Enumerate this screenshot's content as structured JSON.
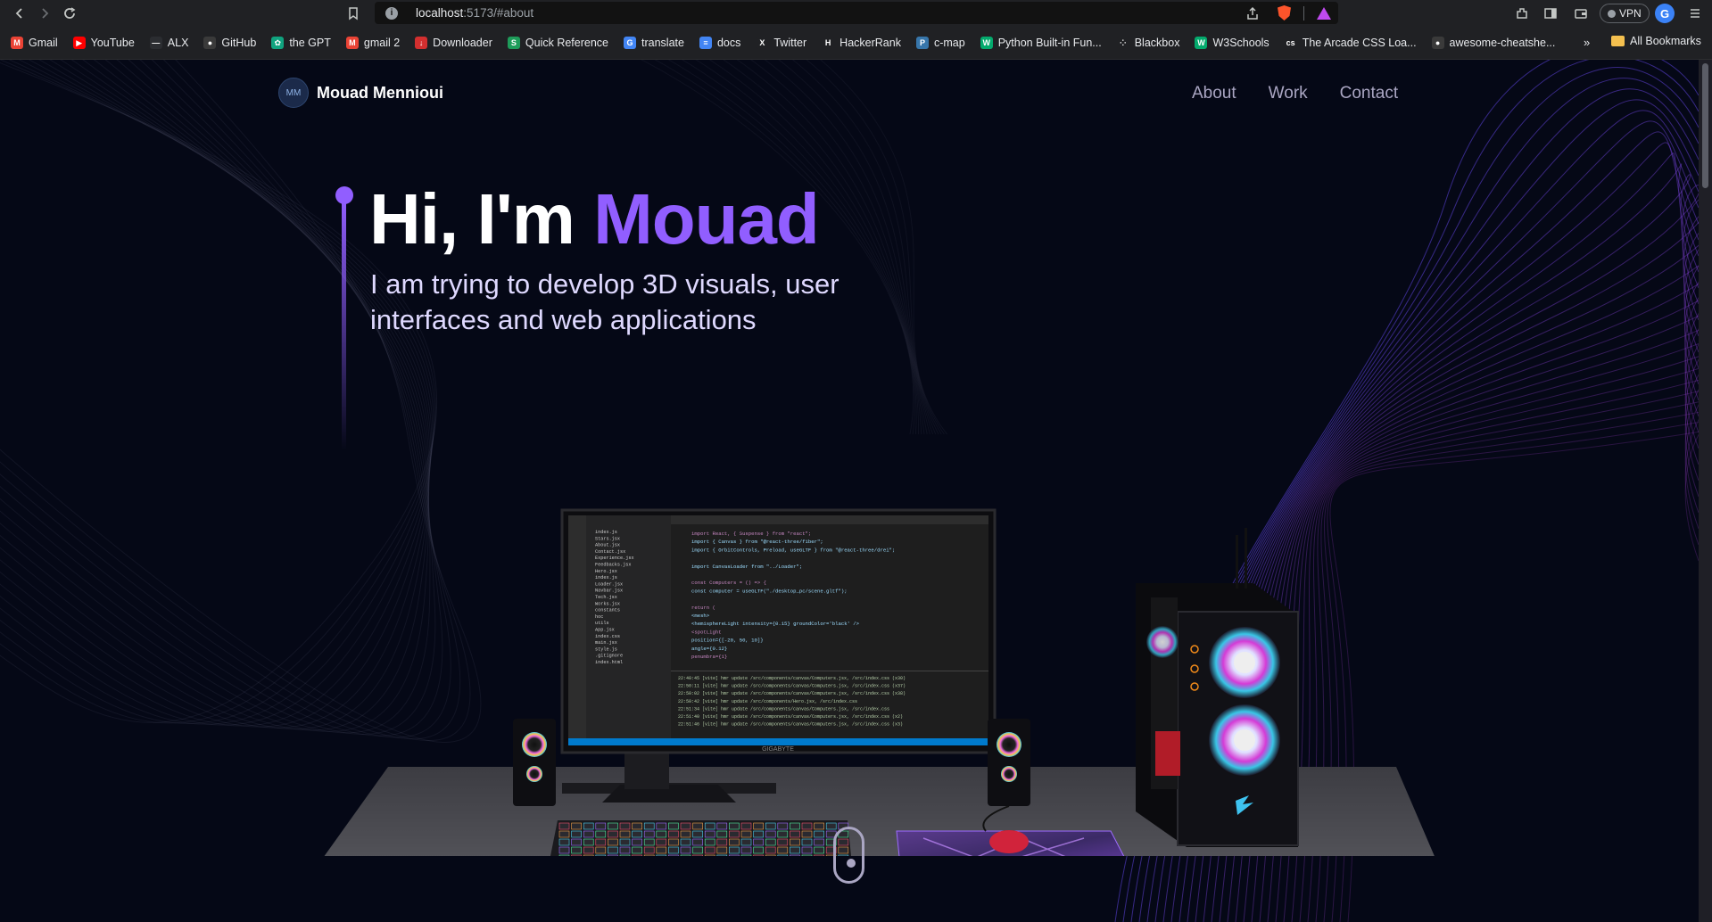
{
  "browser": {
    "url_host": "localhost",
    "url_path": ":5173/#about",
    "vpn_label": "VPN",
    "profile_initial": "G",
    "bookmarks": [
      {
        "label": "Gmail",
        "icon": "gmail-icon",
        "color": "#ea4335",
        "glyph": "M"
      },
      {
        "label": "YouTube",
        "icon": "youtube-icon",
        "color": "#ff0000",
        "glyph": "▶"
      },
      {
        "label": "ALX",
        "icon": "alx-icon",
        "color": "#2b2d31",
        "glyph": "—"
      },
      {
        "label": "GitHub",
        "icon": "github-icon",
        "color": "#3a3a3a",
        "glyph": "●"
      },
      {
        "label": "the GPT",
        "icon": "chatgpt-icon",
        "color": "#10a37f",
        "glyph": "✿"
      },
      {
        "label": "gmail 2",
        "icon": "gmail-icon",
        "color": "#ea4335",
        "glyph": "M"
      },
      {
        "label": "Downloader",
        "icon": "downloader-icon",
        "color": "#d32f2f",
        "glyph": "↓"
      },
      {
        "label": "Quick Reference",
        "icon": "quick-reference-icon",
        "color": "#1e9c5a",
        "glyph": "S"
      },
      {
        "label": "translate",
        "icon": "translate-icon",
        "color": "#4285f4",
        "glyph": "G"
      },
      {
        "label": "docs",
        "icon": "docs-icon",
        "color": "#4285f4",
        "glyph": "≡"
      },
      {
        "label": "Twitter",
        "icon": "x-icon",
        "color": "#202124",
        "glyph": "X"
      },
      {
        "label": "HackerRank",
        "icon": "hackerrank-icon",
        "color": "#202124",
        "glyph": "H"
      },
      {
        "label": "c-map",
        "icon": "python-icon",
        "color": "#3776ab",
        "glyph": "P"
      },
      {
        "label": "Python Built-in Fun...",
        "icon": "w3-icon",
        "color": "#04aa6d",
        "glyph": "W"
      },
      {
        "label": "Blackbox",
        "icon": "blackbox-icon",
        "color": "#202124",
        "glyph": "⁘"
      },
      {
        "label": "W3Schools",
        "icon": "w3schools-icon",
        "color": "#04aa6d",
        "glyph": "W"
      },
      {
        "label": "The Arcade CSS Loa...",
        "icon": "css-icon",
        "color": "#202124",
        "glyph": "cs"
      },
      {
        "label": "awesome-cheatshe...",
        "icon": "github-icon",
        "color": "#3a3a3a",
        "glyph": "●"
      }
    ],
    "more_bookmarks": "»",
    "all_bookmarks": "All Bookmarks"
  },
  "nav": {
    "logo_text": "MM",
    "name": "Mouad  Mennioui",
    "links": [
      "About",
      "Work",
      "Contact"
    ]
  },
  "hero": {
    "greeting": "Hi, I'm ",
    "name": "Mouad",
    "subtitle": "I am trying to develop 3D visuals, user interfaces and web applications"
  },
  "scene": {
    "monitor_brand": "GIGABYTE",
    "code_lines": [
      "import React, { Suspense } from \"react\";",
      "import { Canvas } from \"@react-three/fiber\";",
      "import { OrbitControls, Preload, useGLTF } from \"@react-three/drei\";",
      "",
      "import CanvasLoader from \"../Loader\";",
      "",
      "const Computers = () => {",
      "  const computer = useGLTF(\"./desktop_pc/scene.gltf\");",
      "",
      "  return (",
      "    <mesh>",
      "      <hemisphereLight intensity={0.15} groundColor='black' />",
      "      <spotLight",
      "        position={[-20, 50, 10]}",
      "        angle={0.12}",
      "        penumbra={1}"
    ],
    "files": [
      "index.js",
      "Stars.jsx",
      "About.jsx",
      "Contact.jsx",
      "Experience.jsx",
      "Feedbacks.jsx",
      "Hero.jsx",
      "index.js",
      "Loader.jsx",
      "Navbar.jsx",
      "Tech.jsx",
      "Works.jsx",
      "constants",
      "hoc",
      "utils",
      "App.jsx",
      "index.css",
      "main.jsx",
      "style.js",
      ".gitignore",
      "index.html"
    ],
    "terminal_lines": [
      "22:40:45 [vite] hmr update /src/components/canvas/Computers.jsx, /src/index.css (x30)",
      "22:50:11 [vite] hmr update /src/components/canvas/Computers.jsx, /src/index.css (x37)",
      "22:50:02 [vite] hmr update /src/components/canvas/Computers.jsx, /src/index.css (x38)",
      "22:50:42 [vite] hmr update /src/components/Hero.jsx, /src/index.css",
      "22:51:34 [vite] hmr update /src/components/canvas/Computers.jsx, /src/index.css",
      "22:51:40 [vite] hmr update /src/components/canvas/Computers.jsx, /src/index.css (x2)",
      "22:51:46 [vite] hmr update /src/components/canvas/Computers.jsx, /src/index.css (x3)"
    ]
  },
  "colors": {
    "accent": "#915eff",
    "background": "#050816",
    "nav_text": "#aaa6c3"
  }
}
